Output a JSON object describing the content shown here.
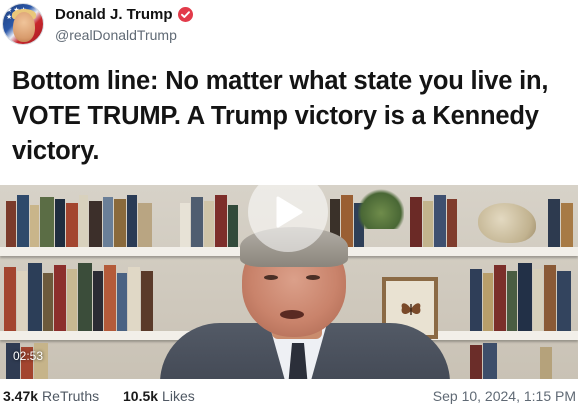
{
  "author": {
    "display_name": "Donald J. Trump",
    "handle": "@realDonaldTrump",
    "verified_icon": "verified-badge-icon",
    "verified_color": "#e23b4a"
  },
  "post": {
    "text": "Bottom line: No matter what state you live in, VOTE TRUMP. A Trump victory is a Kennedy victory."
  },
  "media": {
    "type": "video",
    "duration": "02:53",
    "play_icon": "play-icon"
  },
  "stats": {
    "retruths_count": "3.47k",
    "retruths_label": "ReTruths",
    "likes_count": "10.5k",
    "likes_label": "Likes"
  },
  "timestamp": "Sep 10, 2024, 1:15 PM"
}
